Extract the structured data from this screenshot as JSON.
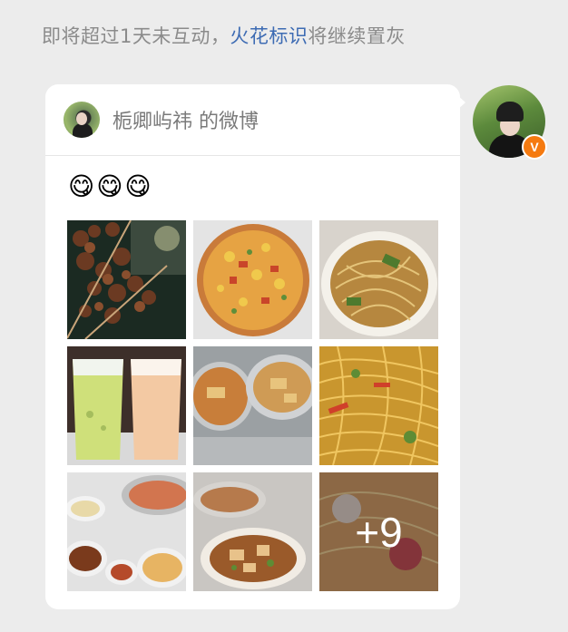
{
  "notice": {
    "prefix": "即将超过1天未互动，",
    "link_text": "火花标识",
    "suffix": "将继续置灰"
  },
  "card": {
    "title": "栀卿屿祎 的微博",
    "emoji_text": "😋😋😋",
    "more_count": "+9",
    "photos": [
      {
        "icon": "food-skewers-photo"
      },
      {
        "icon": "pizza-photo"
      },
      {
        "icon": "noodles-photo"
      },
      {
        "icon": "drinks-photo"
      },
      {
        "icon": "stir-fry-photo"
      },
      {
        "icon": "fried-noodles-photo"
      },
      {
        "icon": "hotpot-table-photo"
      },
      {
        "icon": "soup-bowl-photo"
      },
      {
        "icon": "ramen-photo"
      }
    ]
  },
  "colors": {
    "background": "#ececec",
    "link": "#3d6bb3",
    "verified_badge": "#f57a10"
  }
}
